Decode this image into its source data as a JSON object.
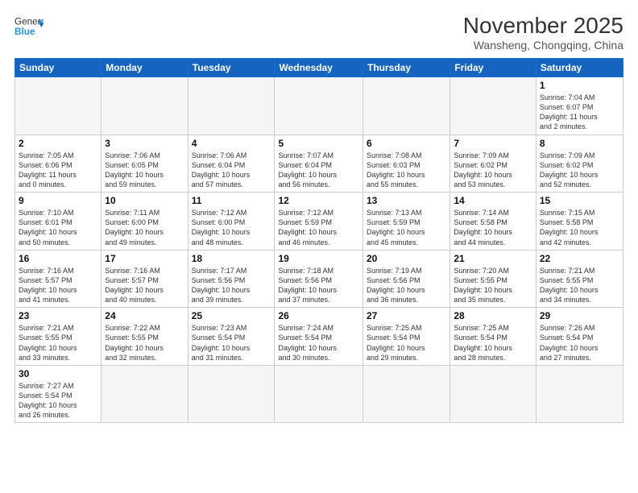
{
  "header": {
    "logo_general": "General",
    "logo_blue": "Blue",
    "month_title": "November 2025",
    "location": "Wansheng, Chongqing, China"
  },
  "weekdays": [
    "Sunday",
    "Monday",
    "Tuesday",
    "Wednesday",
    "Thursday",
    "Friday",
    "Saturday"
  ],
  "weeks": [
    [
      {
        "day": "",
        "info": ""
      },
      {
        "day": "",
        "info": ""
      },
      {
        "day": "",
        "info": ""
      },
      {
        "day": "",
        "info": ""
      },
      {
        "day": "",
        "info": ""
      },
      {
        "day": "",
        "info": ""
      },
      {
        "day": "1",
        "info": "Sunrise: 7:04 AM\nSunset: 6:07 PM\nDaylight: 11 hours\nand 2 minutes."
      }
    ],
    [
      {
        "day": "2",
        "info": "Sunrise: 7:05 AM\nSunset: 6:06 PM\nDaylight: 11 hours\nand 0 minutes."
      },
      {
        "day": "3",
        "info": "Sunrise: 7:06 AM\nSunset: 6:05 PM\nDaylight: 10 hours\nand 59 minutes."
      },
      {
        "day": "4",
        "info": "Sunrise: 7:06 AM\nSunset: 6:04 PM\nDaylight: 10 hours\nand 57 minutes."
      },
      {
        "day": "5",
        "info": "Sunrise: 7:07 AM\nSunset: 6:04 PM\nDaylight: 10 hours\nand 56 minutes."
      },
      {
        "day": "6",
        "info": "Sunrise: 7:08 AM\nSunset: 6:03 PM\nDaylight: 10 hours\nand 55 minutes."
      },
      {
        "day": "7",
        "info": "Sunrise: 7:09 AM\nSunset: 6:02 PM\nDaylight: 10 hours\nand 53 minutes."
      },
      {
        "day": "8",
        "info": "Sunrise: 7:09 AM\nSunset: 6:02 PM\nDaylight: 10 hours\nand 52 minutes."
      }
    ],
    [
      {
        "day": "9",
        "info": "Sunrise: 7:10 AM\nSunset: 6:01 PM\nDaylight: 10 hours\nand 50 minutes."
      },
      {
        "day": "10",
        "info": "Sunrise: 7:11 AM\nSunset: 6:00 PM\nDaylight: 10 hours\nand 49 minutes."
      },
      {
        "day": "11",
        "info": "Sunrise: 7:12 AM\nSunset: 6:00 PM\nDaylight: 10 hours\nand 48 minutes."
      },
      {
        "day": "12",
        "info": "Sunrise: 7:12 AM\nSunset: 5:59 PM\nDaylight: 10 hours\nand 46 minutes."
      },
      {
        "day": "13",
        "info": "Sunrise: 7:13 AM\nSunset: 5:59 PM\nDaylight: 10 hours\nand 45 minutes."
      },
      {
        "day": "14",
        "info": "Sunrise: 7:14 AM\nSunset: 5:58 PM\nDaylight: 10 hours\nand 44 minutes."
      },
      {
        "day": "15",
        "info": "Sunrise: 7:15 AM\nSunset: 5:58 PM\nDaylight: 10 hours\nand 42 minutes."
      }
    ],
    [
      {
        "day": "16",
        "info": "Sunrise: 7:16 AM\nSunset: 5:57 PM\nDaylight: 10 hours\nand 41 minutes."
      },
      {
        "day": "17",
        "info": "Sunrise: 7:16 AM\nSunset: 5:57 PM\nDaylight: 10 hours\nand 40 minutes."
      },
      {
        "day": "18",
        "info": "Sunrise: 7:17 AM\nSunset: 5:56 PM\nDaylight: 10 hours\nand 39 minutes."
      },
      {
        "day": "19",
        "info": "Sunrise: 7:18 AM\nSunset: 5:56 PM\nDaylight: 10 hours\nand 37 minutes."
      },
      {
        "day": "20",
        "info": "Sunrise: 7:19 AM\nSunset: 5:56 PM\nDaylight: 10 hours\nand 36 minutes."
      },
      {
        "day": "21",
        "info": "Sunrise: 7:20 AM\nSunset: 5:55 PM\nDaylight: 10 hours\nand 35 minutes."
      },
      {
        "day": "22",
        "info": "Sunrise: 7:21 AM\nSunset: 5:55 PM\nDaylight: 10 hours\nand 34 minutes."
      }
    ],
    [
      {
        "day": "23",
        "info": "Sunrise: 7:21 AM\nSunset: 5:55 PM\nDaylight: 10 hours\nand 33 minutes."
      },
      {
        "day": "24",
        "info": "Sunrise: 7:22 AM\nSunset: 5:55 PM\nDaylight: 10 hours\nand 32 minutes."
      },
      {
        "day": "25",
        "info": "Sunrise: 7:23 AM\nSunset: 5:54 PM\nDaylight: 10 hours\nand 31 minutes."
      },
      {
        "day": "26",
        "info": "Sunrise: 7:24 AM\nSunset: 5:54 PM\nDaylight: 10 hours\nand 30 minutes."
      },
      {
        "day": "27",
        "info": "Sunrise: 7:25 AM\nSunset: 5:54 PM\nDaylight: 10 hours\nand 29 minutes."
      },
      {
        "day": "28",
        "info": "Sunrise: 7:25 AM\nSunset: 5:54 PM\nDaylight: 10 hours\nand 28 minutes."
      },
      {
        "day": "29",
        "info": "Sunrise: 7:26 AM\nSunset: 5:54 PM\nDaylight: 10 hours\nand 27 minutes."
      }
    ],
    [
      {
        "day": "30",
        "info": "Sunrise: 7:27 AM\nSunset: 5:54 PM\nDaylight: 10 hours\nand 26 minutes."
      },
      {
        "day": "",
        "info": ""
      },
      {
        "day": "",
        "info": ""
      },
      {
        "day": "",
        "info": ""
      },
      {
        "day": "",
        "info": ""
      },
      {
        "day": "",
        "info": ""
      },
      {
        "day": "",
        "info": ""
      }
    ]
  ]
}
